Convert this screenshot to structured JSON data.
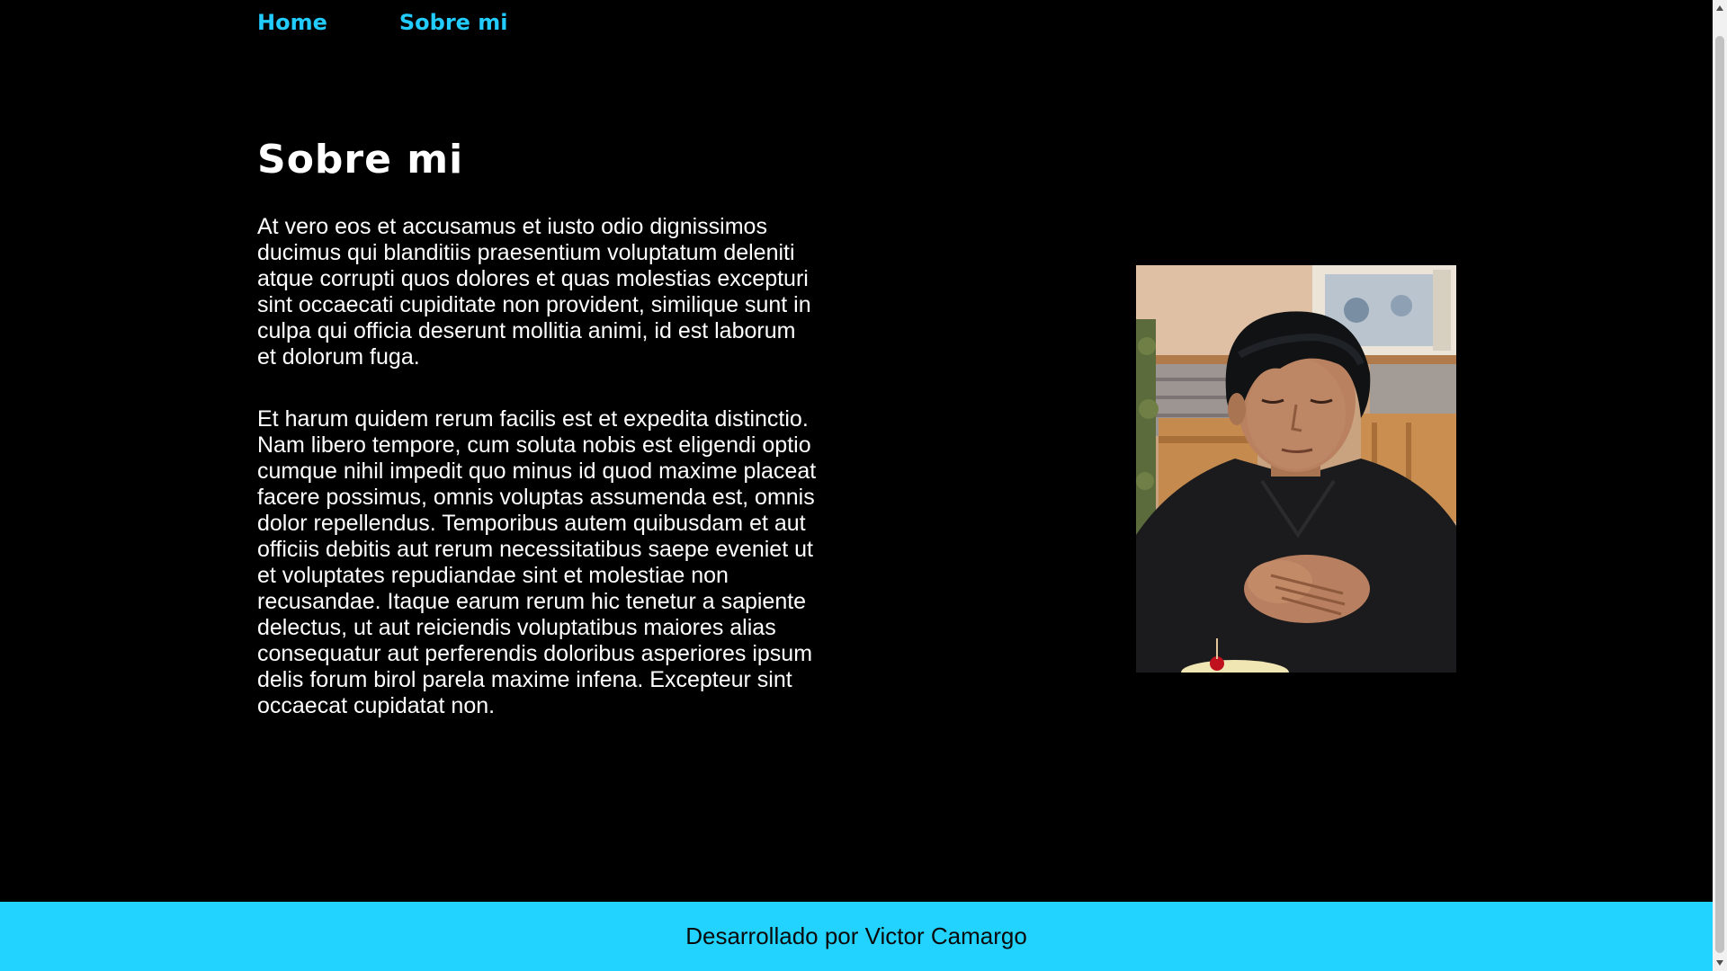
{
  "nav": {
    "items": [
      {
        "label": "Home"
      },
      {
        "label": "Sobre mi"
      }
    ]
  },
  "main": {
    "title": "Sobre mi",
    "paragraphs": [
      "At vero eos et accusamus et iusto odio dignissimos ducimus qui blanditiis praesentium voluptatum deleniti atque corrupti quos dolores et quas molestias excepturi sint occaecati cupiditate non provident, similique sunt in culpa qui officia deserunt mollitia animi, id est laborum et dolorum fuga.",
      "Et harum quidem rerum facilis est et expedita distinctio. Nam libero tempore, cum soluta nobis est eligendi optio cumque nihil impedit quo minus id quod maxime placeat facere possimus, omnis voluptas assumenda est, omnis dolor repellendus. Temporibus autem quibusdam et aut officiis debitis aut rerum necessitatibus saepe eveniet ut et voluptates repudiandae sint et molestiae non recusandae. Itaque earum rerum hic tenetur a sapiente delectus, ut aut reiciendis voluptatibus maiores alias consequatur aut perferendis doloribus asperiores ipsum delis forum birol parela maxime infena. Excepteur sint occaecat cupidatat non."
    ]
  },
  "footer": {
    "text": "Desarrollado por Victor Camargo"
  },
  "colors": {
    "accent": "#22ccff",
    "footer_bg": "#22d3ff",
    "background": "#000000",
    "text": "#ffffff"
  }
}
